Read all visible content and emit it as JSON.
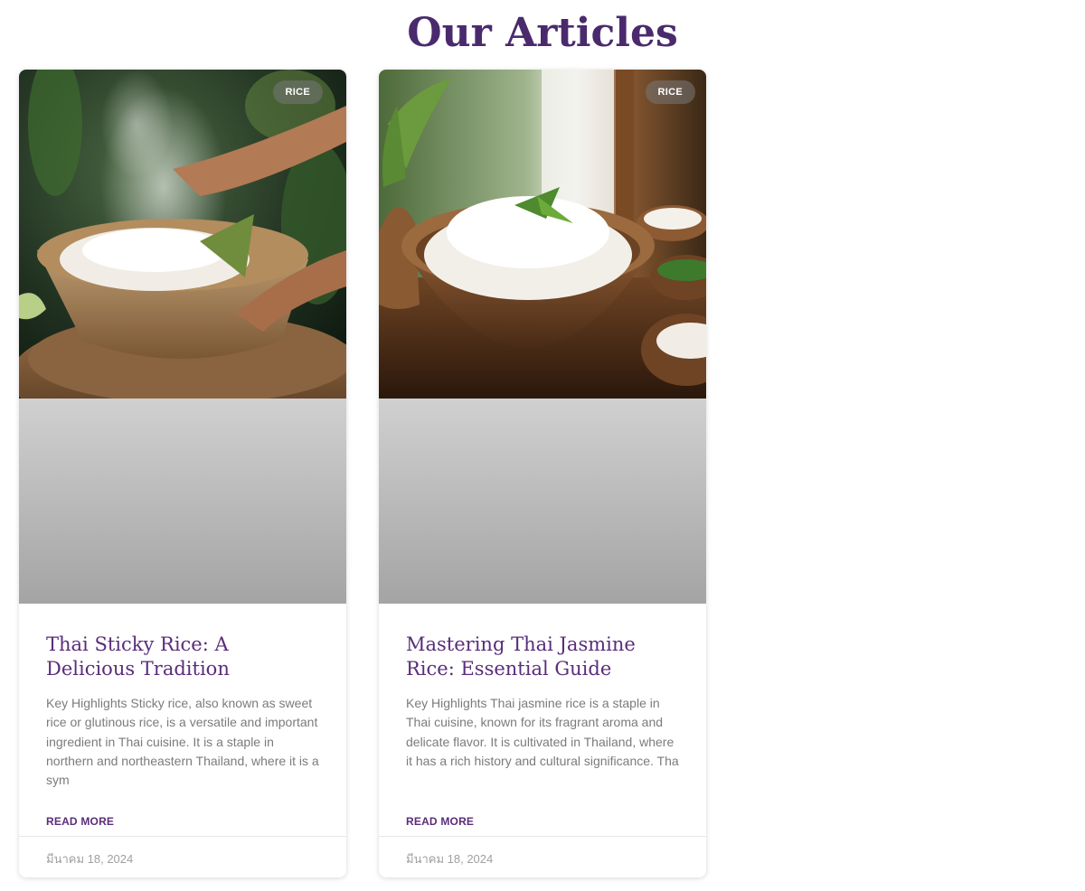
{
  "page": {
    "title": "Our Articles"
  },
  "colors": {
    "accent": "#5a2d7a",
    "title": "#4a2a6d",
    "excerpt": "#7b7b7b",
    "date": "#a0a0a0"
  },
  "articles": [
    {
      "category": "RICE",
      "image_icon": "sticky-rice-basket-photo",
      "title": "Thai Sticky Rice: A Delicious Tradition",
      "excerpt": "Key Highlights Sticky rice, also known as sweet rice or glutinous rice, is a versatile and important ingredient in Thai cuisine. It is a staple in northern and northeastern Thailand, where it is a sym",
      "read_more": "READ MORE",
      "date": "มีนาคม 18, 2024"
    },
    {
      "category": "RICE",
      "image_icon": "jasmine-rice-bowl-photo",
      "title": "Mastering Thai Jasmine Rice: Essential Guide",
      "excerpt": "Key Highlights Thai jasmine rice is a staple in Thai cuisine, known for its fragrant aroma and delicate flavor. It is cultivated in Thailand, where it has a rich history and cultural significance. Tha",
      "read_more": "READ MORE",
      "date": "มีนาคม 18, 2024"
    }
  ]
}
